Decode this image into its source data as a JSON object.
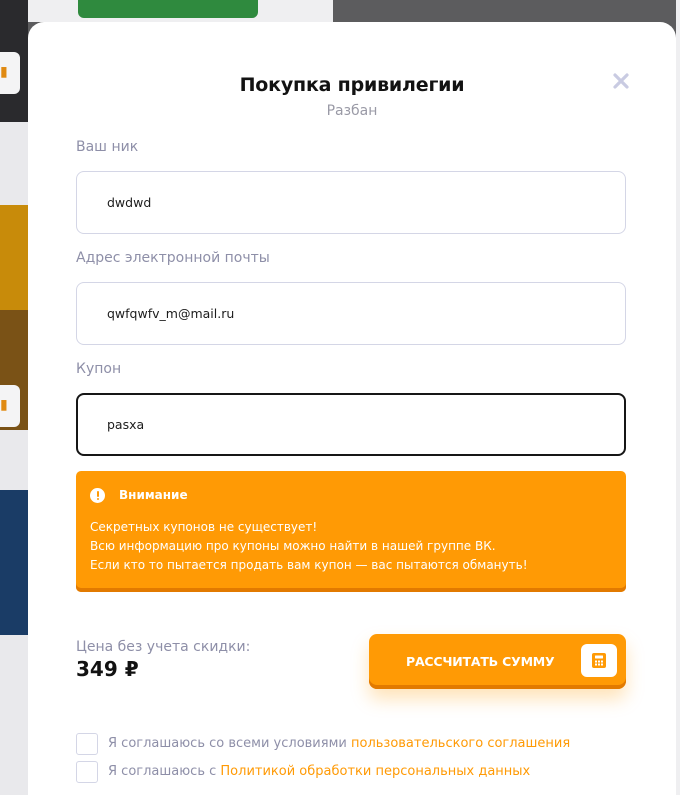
{
  "modal": {
    "title": "Покупка привилегии",
    "subtitle": "Разбан",
    "close_icon": "close-icon"
  },
  "form": {
    "nick_label": "Ваш ник",
    "nick_value": "dwdwd",
    "email_label": "Адрес электронной почты",
    "email_value": "qwfqwfv_m@mail.ru",
    "coupon_label": "Купон",
    "coupon_value": "pasxa"
  },
  "alert": {
    "icon": "warning-icon",
    "title": "Внимание",
    "line1": "Секретных купонов не существует!",
    "line2": "Всю информацию про купоны можно найти в нашей группе ВК.",
    "line3": "Если кто то пытается продать вам купон — вас пытаются обмануть!"
  },
  "price": {
    "label": "Цена без учета скидки:",
    "value": "349 ₽"
  },
  "calculate": {
    "label": "РАССЧИТАТЬ СУММУ",
    "icon": "calculator-icon"
  },
  "agreements": {
    "terms_prefix": "Я соглашаюсь со всеми условиями ",
    "terms_link": "пользовательского соглашения",
    "privacy_prefix": "Я соглашаюсь с ",
    "privacy_link": "Политикой обработки персональных данных"
  },
  "colors": {
    "accent": "#ff9a05",
    "label": "#8e8fa8",
    "overlay": "#5c5c5e"
  }
}
